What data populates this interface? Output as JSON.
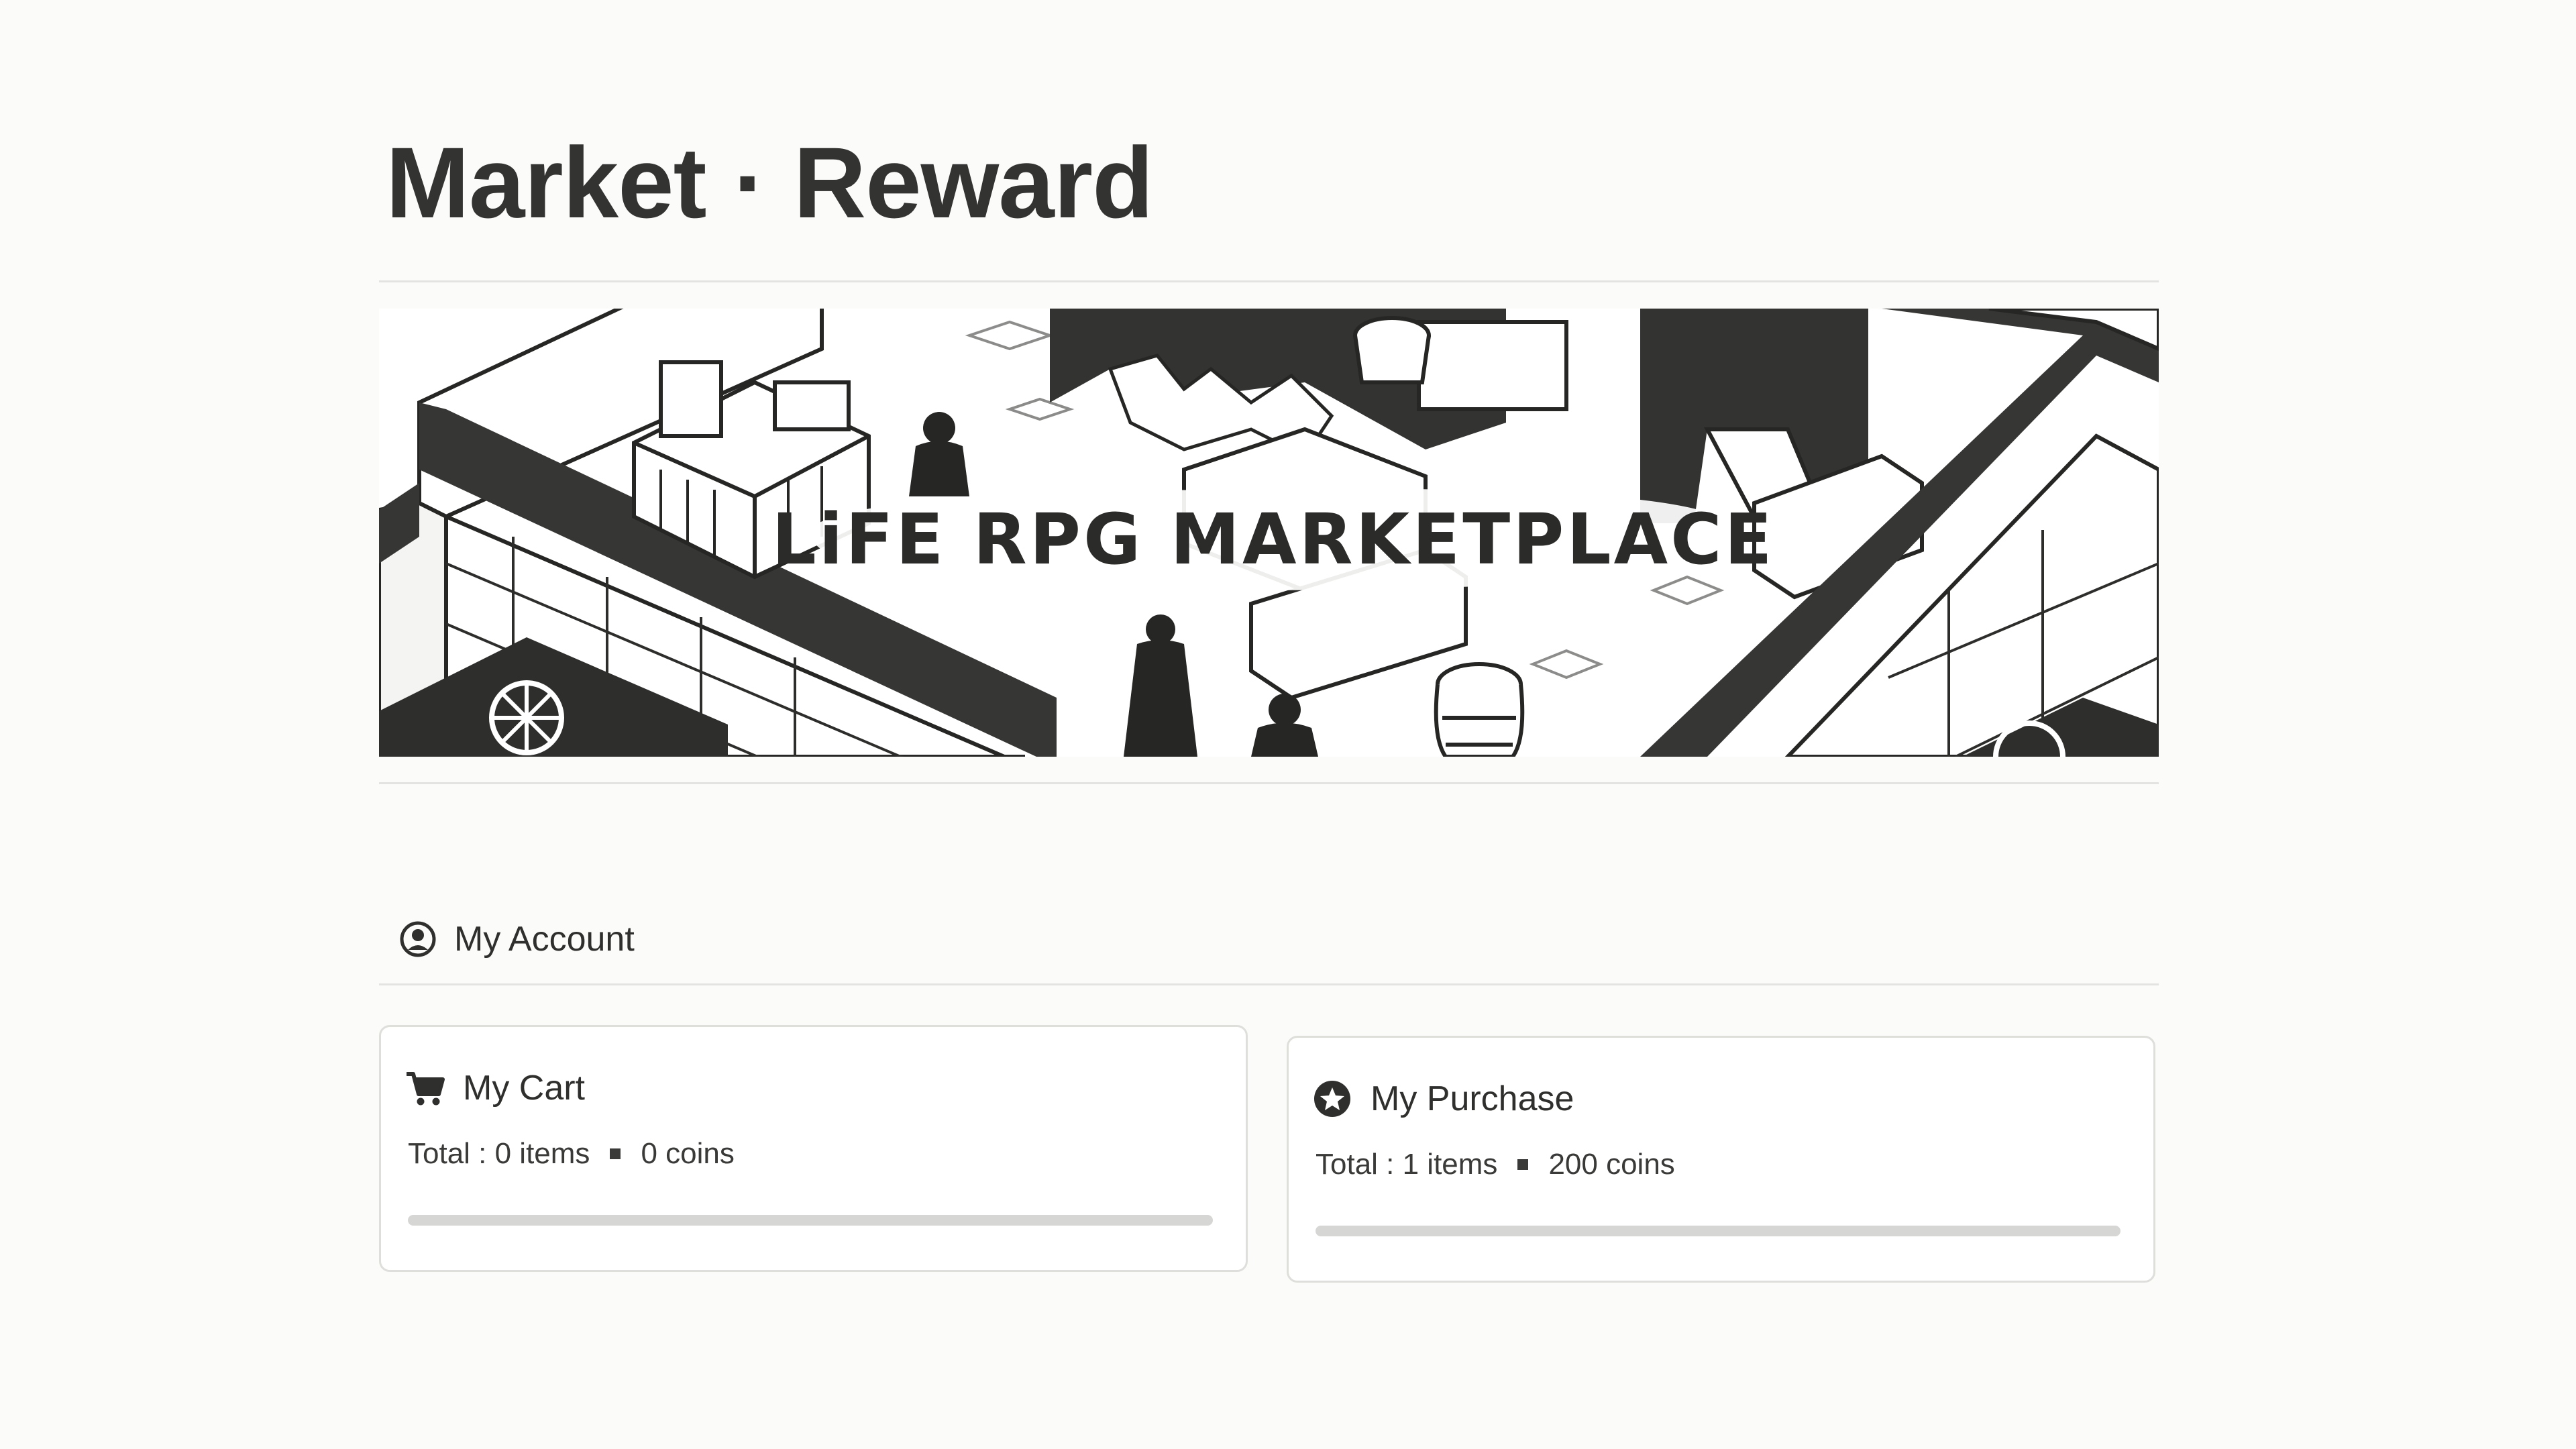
{
  "page": {
    "title": "Market · Reward"
  },
  "banner": {
    "caption": "LiFE RPG MARKETPLACE",
    "image": "isometric-marketplace-illustration"
  },
  "account": {
    "label": "My Account",
    "icon": "user-circle-icon"
  },
  "cards": [
    {
      "id": "cart",
      "title": "My Cart",
      "icon": "shopping-cart-icon",
      "total_label": "Total : 0 items",
      "coins_label": "0 coins",
      "progress": 0
    },
    {
      "id": "purchase",
      "title": "My Purchase",
      "icon": "star-badge-icon",
      "total_label": "Total : 1 items",
      "coins_label": "200 coins",
      "progress": 0
    }
  ],
  "colors": {
    "background": "#fbfbfa",
    "text": "#2f2f2d",
    "divider": "#e3e3e1",
    "bar_track": "#d6d6d4"
  }
}
